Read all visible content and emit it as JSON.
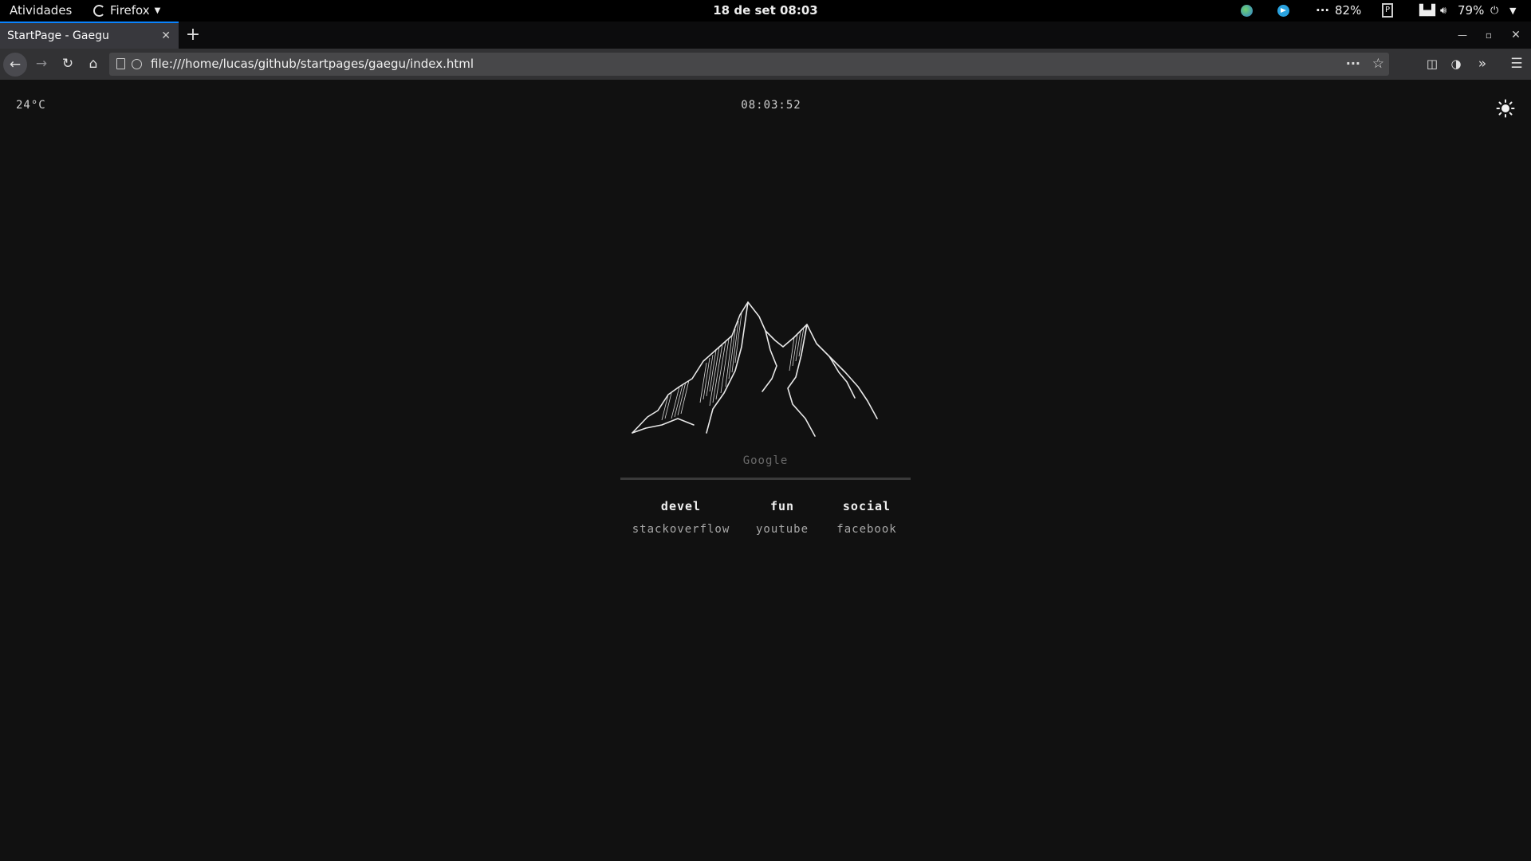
{
  "topbar": {
    "activities": "Atividades",
    "app_menu": "Firefox",
    "clock": "18 de set  08:03",
    "battery": "82%",
    "volume": "79%",
    "tray_more": "···"
  },
  "browser": {
    "tab_title": "StartPage - Gaegu",
    "url": "file:///home/lucas/github/startpages/gaegu/index.html",
    "page_actions": "···"
  },
  "page": {
    "temperature": "24°C",
    "time": "08:03:52",
    "search_placeholder": "Google",
    "categories": [
      {
        "title": "devel",
        "link": "stackoverflow"
      },
      {
        "title": "fun",
        "link": "youtube"
      },
      {
        "title": "social",
        "link": "facebook"
      }
    ]
  },
  "colors": {
    "page_bg": "#111111",
    "tab_accent": "#0a84ff",
    "toolbar": "#323234",
    "urlbar": "#474749"
  },
  "icons": [
    "firefox-icon",
    "globe-icon",
    "telegram-icon",
    "p-icon",
    "network-icon",
    "volume-icon",
    "power-icon",
    "sun-icon",
    "mountain-logo"
  ]
}
